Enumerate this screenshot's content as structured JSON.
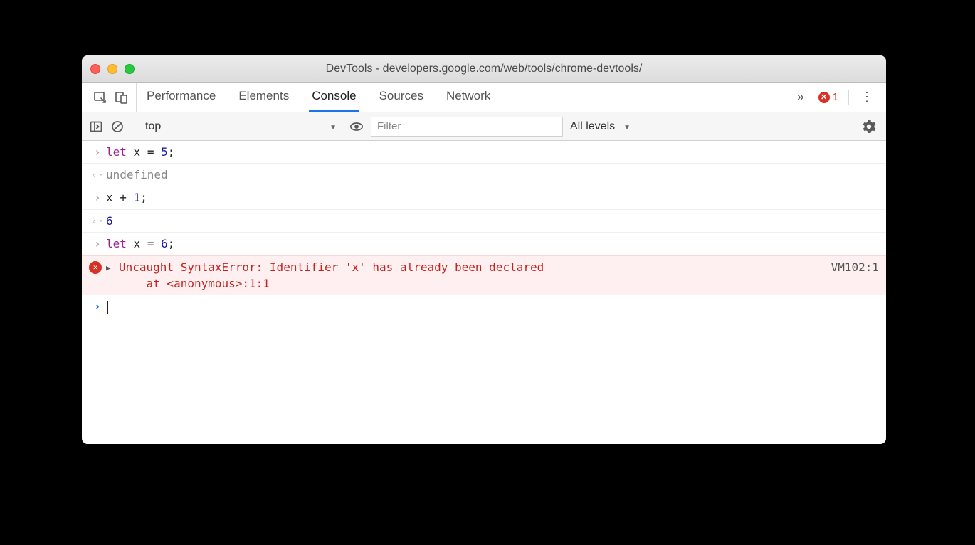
{
  "window": {
    "title": "DevTools - developers.google.com/web/tools/chrome-devtools/"
  },
  "tabs": {
    "items": [
      "Performance",
      "Elements",
      "Console",
      "Sources",
      "Network"
    ],
    "active": "Console",
    "overflow_glyph": "»"
  },
  "errors": {
    "count": "1"
  },
  "filterbar": {
    "context": "top",
    "filter_placeholder": "Filter",
    "filter_value": "",
    "levels_label": "All levels"
  },
  "console": {
    "lines": [
      {
        "kind": "input",
        "tokens": [
          {
            "t": "keyword",
            "v": "let"
          },
          {
            "t": "s",
            "v": " "
          },
          {
            "t": "ident",
            "v": "x"
          },
          {
            "t": "s",
            "v": " "
          },
          {
            "t": "op",
            "v": "="
          },
          {
            "t": "s",
            "v": " "
          },
          {
            "t": "num",
            "v": "5"
          },
          {
            "t": "punc",
            "v": ";"
          }
        ]
      },
      {
        "kind": "output",
        "style": "undef",
        "text": "undefined"
      },
      {
        "kind": "input",
        "tokens": [
          {
            "t": "ident",
            "v": "x"
          },
          {
            "t": "s",
            "v": " "
          },
          {
            "t": "op",
            "v": "+"
          },
          {
            "t": "s",
            "v": " "
          },
          {
            "t": "num",
            "v": "1"
          },
          {
            "t": "punc",
            "v": ";"
          }
        ]
      },
      {
        "kind": "output",
        "style": "num",
        "text": "6"
      },
      {
        "kind": "input",
        "tokens": [
          {
            "t": "keyword",
            "v": "let"
          },
          {
            "t": "s",
            "v": " "
          },
          {
            "t": "ident",
            "v": "x"
          },
          {
            "t": "s",
            "v": " "
          },
          {
            "t": "op",
            "v": "="
          },
          {
            "t": "s",
            "v": " "
          },
          {
            "t": "num",
            "v": "6"
          },
          {
            "t": "punc",
            "v": ";"
          }
        ]
      },
      {
        "kind": "error",
        "message": "Uncaught SyntaxError: Identifier 'x' has already been declared\n    at <anonymous>:1:1",
        "link": "VM102:1"
      },
      {
        "kind": "prompt"
      }
    ]
  }
}
